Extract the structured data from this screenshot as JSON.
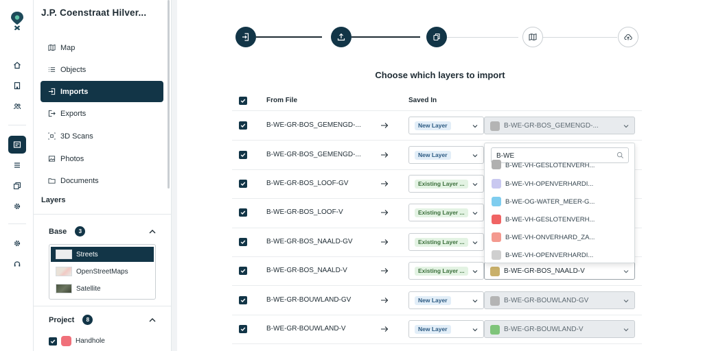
{
  "project_title": "J.P. Coenstraat Hilver...",
  "nav": [
    {
      "label": "Map",
      "icon": "map-icon"
    },
    {
      "label": "Objects",
      "icon": "list-icon"
    },
    {
      "label": "Imports",
      "icon": "import-icon",
      "active": true
    },
    {
      "label": "Exports",
      "icon": "export-icon"
    },
    {
      "label": "3D Scans",
      "icon": "scan-3d-icon"
    },
    {
      "label": "Photos",
      "icon": "image-icon"
    },
    {
      "label": "Documents",
      "icon": "folder-icon"
    }
  ],
  "layers": {
    "title": "Layers",
    "base": {
      "title": "Base",
      "count": "3",
      "items": [
        {
          "label": "Streets",
          "active": true
        },
        {
          "label": "OpenStreetMaps"
        },
        {
          "label": "Satellite"
        }
      ]
    },
    "project": {
      "title": "Project",
      "count": "8",
      "items": [
        {
          "label": "Handhole",
          "color": "#f0707a"
        }
      ]
    }
  },
  "main": {
    "heading": "Choose which layers to import",
    "columns": {
      "from_file": "From File",
      "saved_in": "Saved In"
    },
    "rows": [
      {
        "name": "B-WE-GR-BOS_GEMENGD-...",
        "type": "New Layer",
        "layer": "B-WE-GR-BOS_GEMENGD-...",
        "color": "#b4b4b4"
      },
      {
        "name": "B-WE-GR-BOS_GEMENGD-...",
        "type": "New Layer",
        "layer": "",
        "color": ""
      },
      {
        "name": "B-WE-GR-BOS_LOOF-GV",
        "type": "Existing Layer ...",
        "layer": "",
        "color": ""
      },
      {
        "name": "B-WE-GR-BOS_LOOF-V",
        "type": "Existing Layer ...",
        "layer": "",
        "color": ""
      },
      {
        "name": "B-WE-GR-BOS_NAALD-GV",
        "type": "Existing Layer ...",
        "layer": "",
        "color": ""
      },
      {
        "name": "B-WE-GR-BOS_NAALD-V",
        "type": "Existing Layer ...",
        "layer": "B-WE-GR-BOS_NAALD-V",
        "color": "#c9b06a"
      },
      {
        "name": "B-WE-GR-BOUWLAND-GV",
        "type": "New Layer",
        "layer": "B-WE-GR-BOUWLAND-GV",
        "color": "#b4b4b4"
      },
      {
        "name": "B-WE-GR-BOUWLAND-V",
        "type": "New Layer",
        "layer": "B-WE-GR-BOUWLAND-V",
        "color": "#7fc47a"
      }
    ],
    "dropdown": {
      "search_value": "B-WE",
      "items": [
        {
          "label": "B-WE-VH-GESLOTENVERH...",
          "color": "#b0b0b0"
        },
        {
          "label": "B-WE-VH-OPENVERHARDI...",
          "color": "#c9c8f0"
        },
        {
          "label": "B-WE-OG-WATER_MEER-G...",
          "color": "#7fcdef"
        },
        {
          "label": "B-WE-VH-GESLOTENVERH...",
          "color": "#f06464"
        },
        {
          "label": "B-WE-VH-ONVERHARD_ZA...",
          "color": "#f4998f"
        },
        {
          "label": "B-WE-VH-OPENVERHARDI...",
          "color": "#cfcfcf"
        }
      ]
    }
  },
  "colors": {
    "primary": "#123547",
    "accent_line": "#1e2b33",
    "inactive_line": "#d4d9dc"
  }
}
